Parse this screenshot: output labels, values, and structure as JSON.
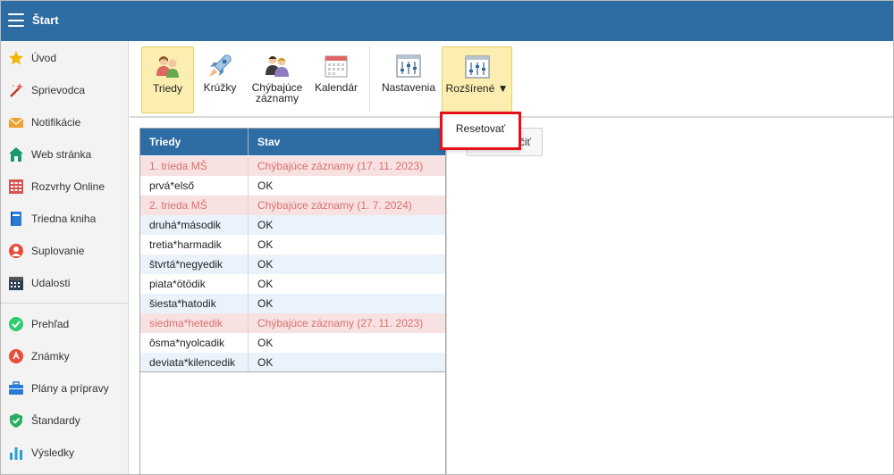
{
  "app": {
    "title": "Štart"
  },
  "sidebar": {
    "items": [
      {
        "label": "Úvod",
        "icon": "star-icon"
      },
      {
        "label": "Sprievodca",
        "icon": "magic-wand-icon"
      },
      {
        "label": "Notifikácie",
        "icon": "envelope-icon"
      },
      {
        "label": "Web stránka",
        "icon": "house-icon"
      },
      {
        "label": "Rozvrhy Online",
        "icon": "timetable-icon"
      },
      {
        "label": "Triedna kniha",
        "icon": "book-icon"
      },
      {
        "label": "Suplovanie",
        "icon": "substitute-icon"
      },
      {
        "label": "Udalosti",
        "icon": "calendar-icon"
      },
      {
        "label": "Prehľad",
        "icon": "check-circle-icon"
      },
      {
        "label": "Známky",
        "icon": "grades-icon"
      },
      {
        "label": "Plány a prípravy",
        "icon": "briefcase-icon"
      },
      {
        "label": "Štandardy",
        "icon": "shield-check-icon"
      },
      {
        "label": "Výsledky",
        "icon": "bar-chart-icon"
      }
    ]
  },
  "toolbar": {
    "buttons": [
      {
        "label": "Triedy",
        "icon": "classes-icon",
        "active": true
      },
      {
        "label": "Krúžky",
        "icon": "rocket-icon",
        "active": false
      },
      {
        "label_line1": "Chýbajúce",
        "label_line2": "záznamy",
        "icon": "missing-records-icon",
        "active": false
      },
      {
        "label": "Kalendár",
        "icon": "calendar-grid-icon",
        "active": false
      },
      {
        "label": "Nastavenia",
        "icon": "sliders-icon",
        "active": false
      },
      {
        "label": "Rozšírené ▼",
        "icon": "sliders-icon",
        "active": true
      }
    ]
  },
  "dropdown": {
    "items": [
      {
        "label": "Resetovať"
      }
    ]
  },
  "background_button": {
    "label_visible": "čiť"
  },
  "table": {
    "columns": [
      "Triedy",
      "Stav"
    ],
    "rows": [
      {
        "trieda": "1. trieda MŠ",
        "stav": "Chýbajúce záznamy (17. 11. 2023)",
        "status": "warn"
      },
      {
        "trieda": "prvá*első",
        "stav": "OK",
        "status": "ok"
      },
      {
        "trieda": "2. trieda MŠ",
        "stav": "Chýbajúce záznamy (1. 7. 2024)",
        "status": "warn"
      },
      {
        "trieda": "druhá*második",
        "stav": "OK",
        "status": "ok"
      },
      {
        "trieda": "tretia*harmadik",
        "stav": "OK",
        "status": "ok"
      },
      {
        "trieda": "štvrtá*negyedik",
        "stav": "OK",
        "status": "ok"
      },
      {
        "trieda": "piata*ötödik",
        "stav": "OK",
        "status": "ok"
      },
      {
        "trieda": "šiesta*hatodik",
        "stav": "OK",
        "status": "ok"
      },
      {
        "trieda": "siedma*hetedik",
        "stav": "Chýbajúce záznamy (27. 11. 2023)",
        "status": "warn"
      },
      {
        "trieda": "ôsma*nyolcadik",
        "stav": "OK",
        "status": "ok"
      },
      {
        "trieda": "deviata*kilencedik",
        "stav": "OK",
        "status": "ok"
      }
    ]
  },
  "colors": {
    "header_blue": "#2e6da4",
    "active_button_bg": "#fbeeb0",
    "warn_row_bg": "#f8e1e1",
    "warn_text": "#d9706e",
    "alt_row_bg": "#eaf2fb",
    "highlight_border": "#e8101a"
  }
}
